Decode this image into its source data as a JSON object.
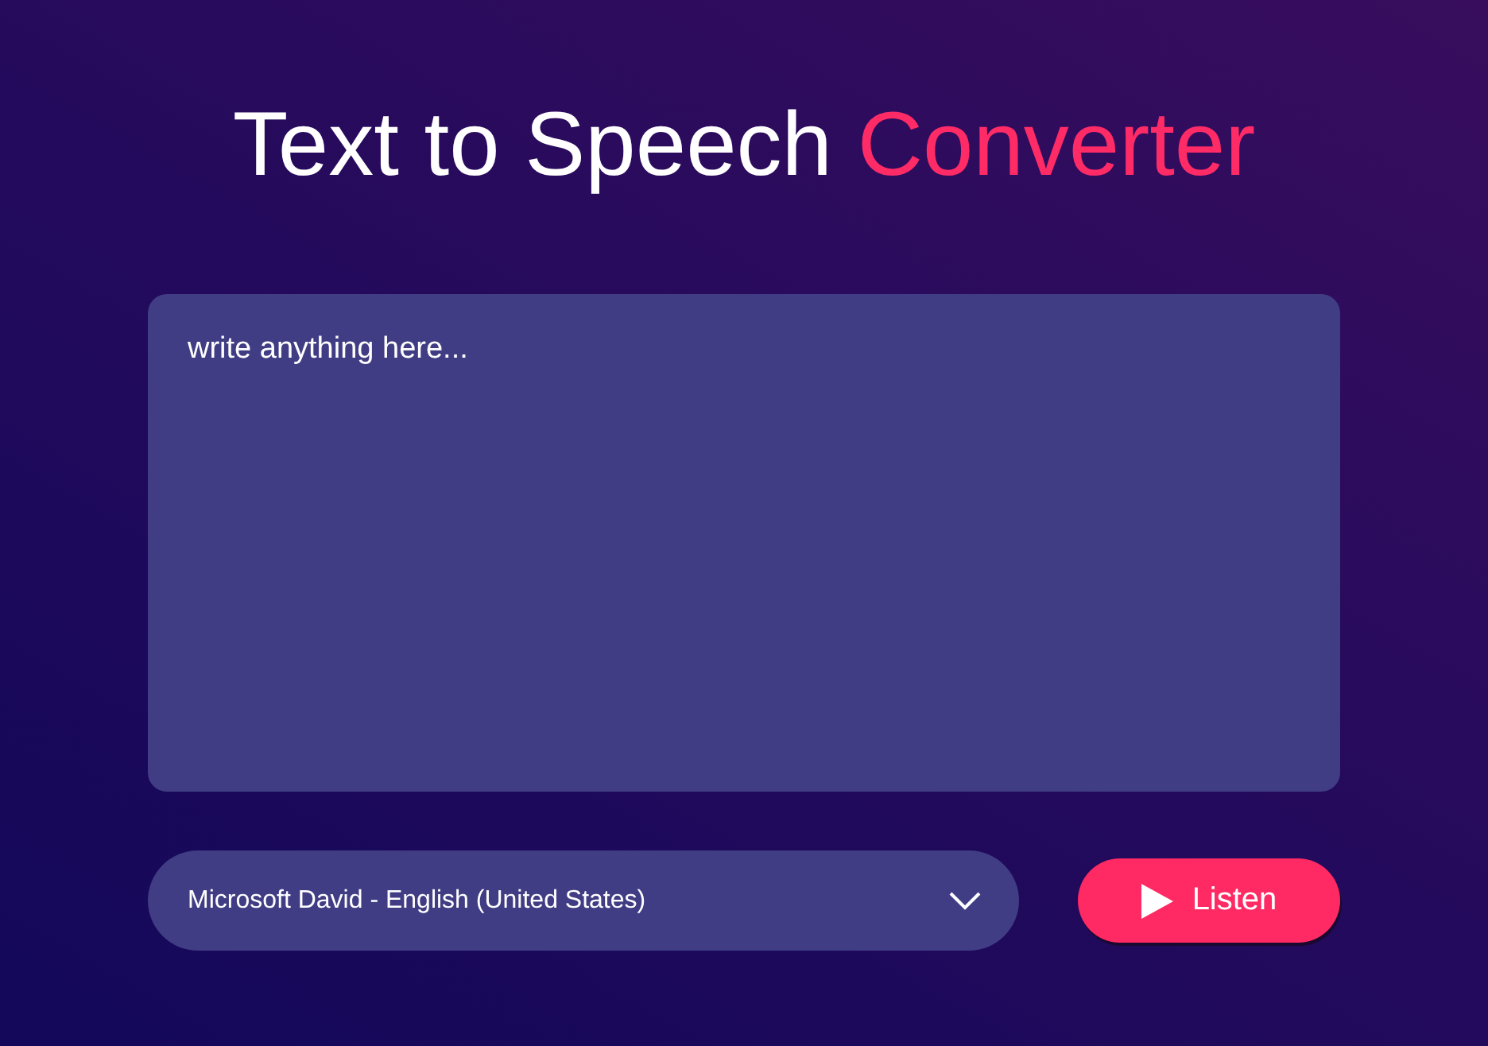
{
  "title": {
    "text": "Text to Speech",
    "highlight": "Converter"
  },
  "text_input": {
    "placeholder": "write anything here..."
  },
  "voice_select": {
    "value": "Microsoft David - English (United States)"
  },
  "listen_button": {
    "label": "Listen"
  }
}
